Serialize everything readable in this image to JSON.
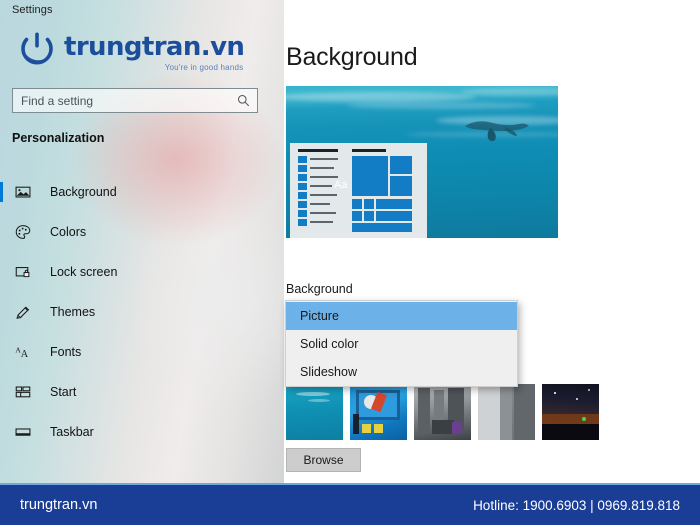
{
  "window": {
    "title": "Settings"
  },
  "brand": {
    "name": "trungtran.vn",
    "tagline": "You're in good hands",
    "logo_icon": "power-icon",
    "logo_color": "#1b4f9c"
  },
  "search": {
    "placeholder": "Find a setting",
    "value": "Find a setting",
    "icon": "search-icon"
  },
  "sidebar": {
    "heading": "Personalization",
    "items": [
      {
        "label": "Background",
        "icon": "image-icon",
        "selected": true
      },
      {
        "label": "Colors",
        "icon": "palette-icon",
        "selected": false
      },
      {
        "label": "Lock screen",
        "icon": "lock-screen-icon",
        "selected": false
      },
      {
        "label": "Themes",
        "icon": "paintbrush-icon",
        "selected": false
      },
      {
        "label": "Fonts",
        "icon": "fonts-aa-icon",
        "selected": false
      },
      {
        "label": "Start",
        "icon": "start-grid-icon",
        "selected": false
      },
      {
        "label": "Taskbar",
        "icon": "taskbar-icon",
        "selected": false
      }
    ],
    "accent_color": "#0078d7"
  },
  "main": {
    "page_title": "Background",
    "preview": {
      "name": "desktop-preview",
      "sample_text": "Aa"
    },
    "background_label": "Background",
    "dropdown": {
      "selected": "Picture",
      "options": [
        {
          "label": "Picture",
          "active": true
        },
        {
          "label": "Solid color",
          "active": false
        },
        {
          "label": "Slideshow",
          "active": false
        }
      ],
      "highlight_color": "#6cb2e8"
    },
    "recent_images": [
      {
        "name": "underwater-ocean"
      },
      {
        "name": "blue-tech-desk"
      },
      {
        "name": "motherboard-gray"
      },
      {
        "name": "rock-face-gray"
      },
      {
        "name": "night-sky-sunset"
      }
    ],
    "browse_label": "Browse"
  },
  "footer": {
    "brand": "trungtran.vn",
    "hotline": "Hotline: 1900.6903  |  0969.819.818",
    "background_color": "#1a3d96"
  }
}
